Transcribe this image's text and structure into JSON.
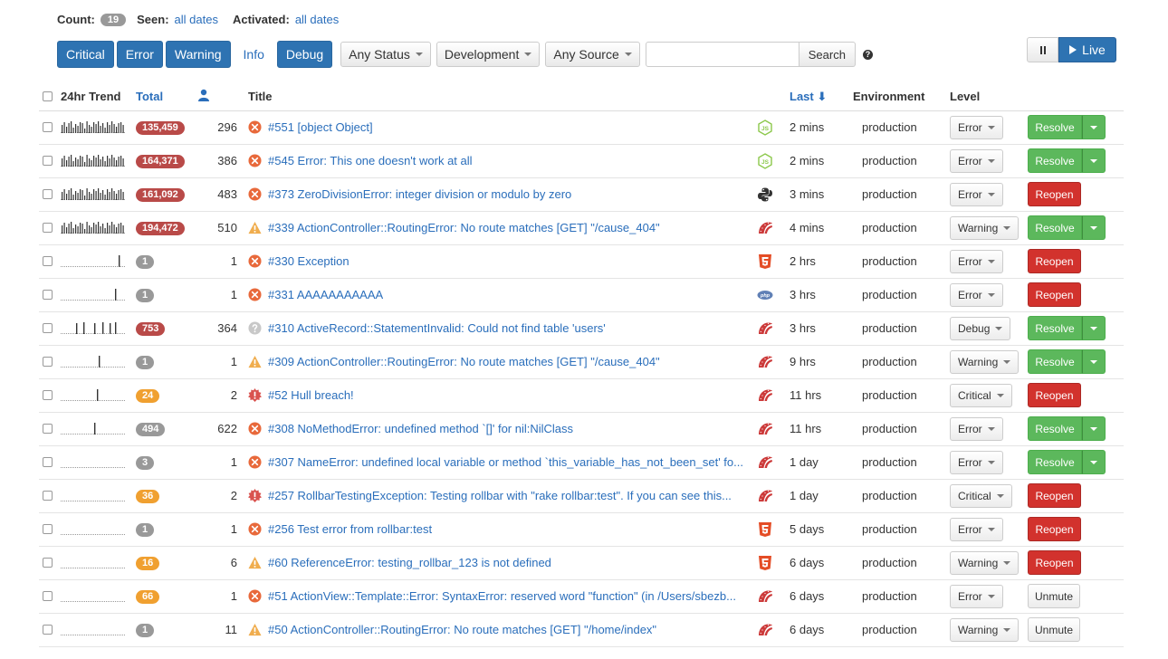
{
  "summary": {
    "count_label": "Count:",
    "count": "19",
    "seen_label": "Seen:",
    "seen_value": "all dates",
    "activated_label": "Activated:",
    "activated_value": "all dates"
  },
  "toolbar": {
    "levels": [
      {
        "label": "Critical",
        "active": true
      },
      {
        "label": "Error",
        "active": true
      },
      {
        "label": "Warning",
        "active": true
      },
      {
        "label": "Info",
        "active": false
      },
      {
        "label": "Debug",
        "active": true
      }
    ],
    "status_filter": "Any Status",
    "environment_filter": "Development",
    "source_filter": "Any Source",
    "search_placeholder": "",
    "search_label": "Search",
    "help_glyph": "?",
    "live_label": "Live"
  },
  "table": {
    "headers": {
      "trend": "24hr Trend",
      "total": "Total",
      "title": "Title",
      "last": "Last",
      "last_arrow": "⬇",
      "environment": "Environment",
      "level": "Level"
    },
    "colors": {
      "red": "#b94a48",
      "orange": "#f0a030",
      "gray": "#999999",
      "error_icon": "#e8693b",
      "warning_icon": "#f0ad4e",
      "critical_icon": "#d9534f",
      "resolve": "#5cb85c",
      "reopen": "#d2322d"
    },
    "rows": [
      {
        "trend": "dense",
        "total": "135,459",
        "badge": "red",
        "users": "296",
        "icon": "error-icon",
        "title": "#551 [object Object]",
        "fw": "nodejs-icon",
        "last": "2 mins",
        "env": "production",
        "level": "Error",
        "action": "Resolve"
      },
      {
        "trend": "dense",
        "total": "164,371",
        "badge": "red",
        "users": "386",
        "icon": "error-icon",
        "title": "#545 Error: This one doesn't work at all",
        "fw": "nodejs-icon",
        "last": "2 mins",
        "env": "production",
        "level": "Error",
        "action": "Resolve"
      },
      {
        "trend": "dense",
        "total": "161,092",
        "badge": "red",
        "users": "483",
        "icon": "error-icon",
        "title": "#373 ZeroDivisionError: integer division or modulo by zero",
        "fw": "python-icon",
        "last": "3 mins",
        "env": "production",
        "level": "Error",
        "action": "Reopen"
      },
      {
        "trend": "dense",
        "total": "194,472",
        "badge": "red",
        "users": "510",
        "icon": "warning-icon",
        "title": "#339 ActionController::RoutingError: No route matches [GET] \"/cause_404\"",
        "fw": "rails-icon",
        "last": "4 mins",
        "env": "production",
        "level": "Warning",
        "action": "Resolve"
      },
      {
        "trend": "spike-late",
        "total": "1",
        "badge": "gray",
        "users": "1",
        "icon": "error-icon",
        "title": "#330 Exception",
        "fw": "html5-icon",
        "last": "2 hrs",
        "env": "production",
        "level": "Error",
        "action": "Reopen"
      },
      {
        "trend": "spike-late2",
        "total": "1",
        "badge": "gray",
        "users": "1",
        "icon": "error-icon",
        "title": "#331 AAAAAAAAAAA",
        "fw": "php-icon",
        "last": "3 hrs",
        "env": "production",
        "level": "Error",
        "action": "Reopen"
      },
      {
        "trend": "multi",
        "total": "753",
        "badge": "red",
        "users": "364",
        "icon": "debug-icon",
        "title": "#310 ActiveRecord::StatementInvalid: Could not find table 'users'",
        "fw": "rails-icon",
        "last": "3 hrs",
        "env": "production",
        "level": "Debug",
        "action": "Resolve"
      },
      {
        "trend": "spike-mid",
        "total": "1",
        "badge": "gray",
        "users": "1",
        "icon": "warning-icon",
        "title": "#309 ActionController::RoutingError: No route matches [GET] \"/cause_404\"",
        "fw": "rails-icon",
        "last": "9 hrs",
        "env": "production",
        "level": "Warning",
        "action": "Resolve"
      },
      {
        "trend": "spike-mid2",
        "total": "24",
        "badge": "orange",
        "users": "2",
        "icon": "critical-icon",
        "title": "#52 Hull breach!",
        "fw": "rails-icon",
        "last": "11 hrs",
        "env": "production",
        "level": "Critical",
        "action": "Reopen"
      },
      {
        "trend": "spike-mid3",
        "total": "494",
        "badge": "gray",
        "users": "622",
        "icon": "error-icon",
        "title": "#308 NoMethodError: undefined method `[]' for nil:NilClass",
        "fw": "rails-icon",
        "last": "11 hrs",
        "env": "production",
        "level": "Error",
        "action": "Resolve"
      },
      {
        "trend": "flat",
        "total": "3",
        "badge": "gray",
        "users": "1",
        "icon": "error-icon",
        "title": "#307 NameError: undefined local variable or method `this_variable_has_not_been_set' fo...",
        "fw": "rails-icon",
        "last": "1 day",
        "env": "production",
        "level": "Error",
        "action": "Resolve"
      },
      {
        "trend": "flat",
        "total": "36",
        "badge": "orange",
        "users": "2",
        "icon": "critical-icon",
        "title": "#257 RollbarTestingException: Testing rollbar with \"rake rollbar:test\". If you can see this...",
        "fw": "rails-icon",
        "last": "1 day",
        "env": "production",
        "level": "Critical",
        "action": "Reopen"
      },
      {
        "trend": "flat",
        "total": "1",
        "badge": "gray",
        "users": "1",
        "icon": "error-icon",
        "title": "#256 Test error from rollbar:test",
        "fw": "html5-icon",
        "last": "5 days",
        "env": "production",
        "level": "Error",
        "action": "Reopen"
      },
      {
        "trend": "flat",
        "total": "16",
        "badge": "orange",
        "users": "6",
        "icon": "warning-icon",
        "title": "#60 ReferenceError: testing_rollbar_123 is not defined",
        "fw": "html5-icon",
        "last": "6 days",
        "env": "production",
        "level": "Warning",
        "action": "Reopen"
      },
      {
        "trend": "flat",
        "total": "66",
        "badge": "orange",
        "users": "1",
        "icon": "error-icon",
        "title": "#51 ActionView::Template::Error: SyntaxError: reserved word \"function\" (in /Users/sbezb...",
        "fw": "rails-icon",
        "last": "6 days",
        "env": "production",
        "level": "Error",
        "action": "Unmute"
      },
      {
        "trend": "flat",
        "total": "1",
        "badge": "gray",
        "users": "11",
        "icon": "warning-icon",
        "title": "#50 ActionController::RoutingError: No route matches [GET] \"/home/index\"",
        "fw": "rails-icon",
        "last": "6 days",
        "env": "production",
        "level": "Warning",
        "action": "Unmute"
      }
    ]
  }
}
